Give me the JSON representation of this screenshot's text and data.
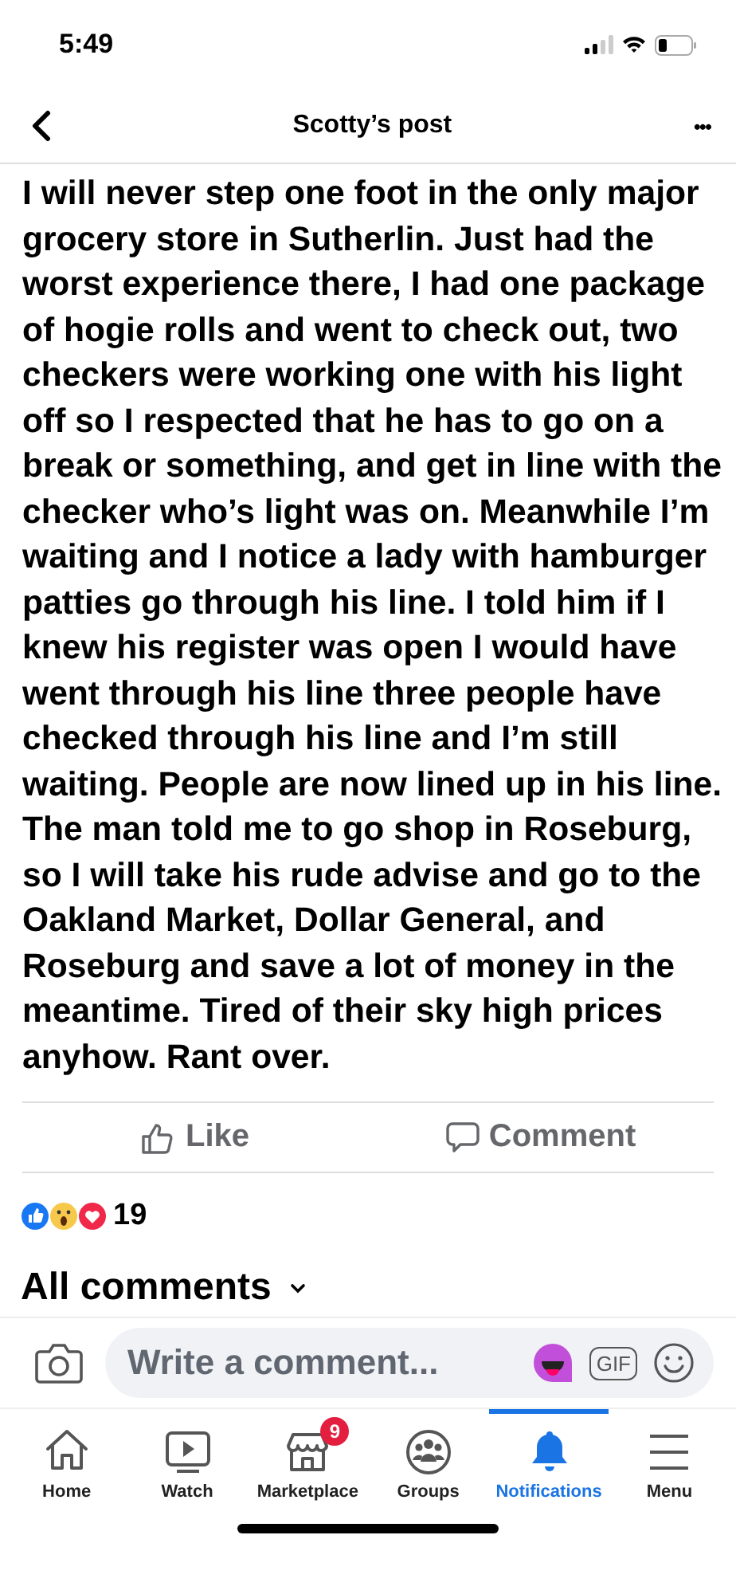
{
  "status_bar": {
    "time": "5:49"
  },
  "header": {
    "title": "Scotty’s post",
    "more": "•••"
  },
  "post": {
    "text": "I will never step one foot in the only major grocery store in Sutherlin. Just had the worst experience there, I had one package of hogie rolls and went to check out, two checkers were working one with his light off so I respected that he has to go on a break or something, and get in line with the checker who’s light was on. Meanwhile I’m waiting and I notice a lady with hamburger patties go through his line. I told him if I knew his register was open I would have went through his line three people have checked through his line and I’m still waiting. People are now lined up in his line. The man told me to go shop in Roseburg, so I will take his rude advise and go to the Oakland Market, Dollar General, and Roseburg and save a lot of money in the meantime. Tired of their sky high prices anyhow. Rant over."
  },
  "actions": [
    {
      "kind": "like",
      "label": "Like"
    },
    {
      "kind": "comment",
      "label": "Comment"
    }
  ],
  "reactions": {
    "count": "19"
  },
  "comments_sort": {
    "label": "All comments"
  },
  "comment_bar": {
    "placeholder": "Write a comment...",
    "gif": "GIF"
  },
  "nav": [
    {
      "kind": "home",
      "label": "Home",
      "selected": false
    },
    {
      "kind": "watch",
      "label": "Watch",
      "selected": false
    },
    {
      "kind": "marketplace",
      "label": "Marketplace",
      "selected": false,
      "badge": "9"
    },
    {
      "kind": "groups",
      "label": "Groups",
      "selected": false
    },
    {
      "kind": "notifications",
      "label": "Notifications",
      "selected": true
    },
    {
      "kind": "menu",
      "label": "Menu",
      "selected": false
    }
  ]
}
